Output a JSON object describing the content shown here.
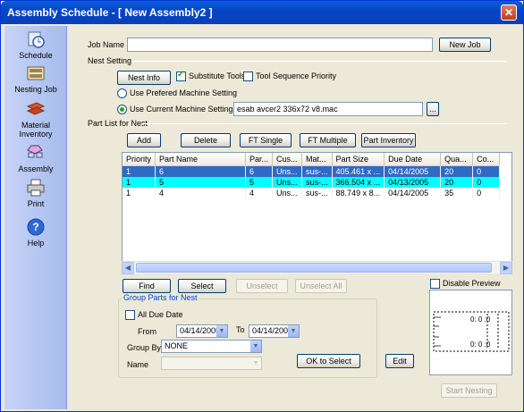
{
  "window": {
    "title": "Assembly Schedule - [ New Assembly2 ]",
    "close_glyph": "✕"
  },
  "sidebar": {
    "items": [
      {
        "label": "Schedule",
        "icon": "clock-icon"
      },
      {
        "label": "Nesting Job",
        "icon": "keyboard-icon"
      },
      {
        "label": "Material Inventory",
        "icon": "material-stack-icon"
      },
      {
        "label": "Assembly",
        "icon": "assembly-icon"
      },
      {
        "label": "Print",
        "icon": "printer-icon"
      },
      {
        "label": "Help",
        "icon": "help-icon"
      }
    ]
  },
  "job": {
    "label": "Job Name",
    "value": "",
    "new_job": "New Job"
  },
  "nest_setting": {
    "section": "Nest Setting",
    "nest_info": "Nest Info",
    "substitute_tools": "Substitute Tools",
    "tool_sequence": "Tool Sequence Priority",
    "use_preferred": "Use Prefered Machine Setting",
    "use_current": "Use Current Machine Setting",
    "machine_value": "esab avcer2 336x72 v8.mac",
    "browse": "..."
  },
  "part_list": {
    "section": "Part List for Nest",
    "buttons": [
      "Add",
      "Delete",
      "FT Single",
      "FT Multiple",
      "Part Inventory"
    ],
    "columns": [
      "Priority",
      "Part Name",
      "Par...",
      "Cus...",
      "Mat...",
      "Part Size",
      "Due Date",
      "Qua...",
      "Co..."
    ],
    "rows": [
      [
        "1",
        "6",
        "6",
        "Uns...",
        "sus-...",
        "405.461 x ...",
        "04/14/2005",
        "20",
        "0"
      ],
      [
        "1",
        "5",
        "5",
        "Uns...",
        "sus-...",
        "366.504 x ...",
        "04/13/2005",
        "20",
        "0"
      ],
      [
        "1",
        "4",
        "4",
        "Uns...",
        "sus-...",
        "88.749 x 8...",
        "04/14/2005",
        "35",
        "0"
      ]
    ]
  },
  "actions": {
    "find": "Find",
    "select": "Select",
    "unselect": "Unselect",
    "unselect_all": "Unselect All"
  },
  "group": {
    "title": "Group Parts for Nest",
    "all_due_date": "All Due Date",
    "from_label": "From",
    "from_value": "04/14/2005",
    "to_label": "To",
    "to_value": "04/14/2005",
    "group_by_label": "Group By",
    "group_by_value": "NONE",
    "name_label": "Name",
    "name_value": "",
    "ok_to_select": "OK to Select"
  },
  "edit": "Edit",
  "disable_preview": "Disable Preview",
  "start_nesting": "Start Nesting",
  "colors": {
    "selected_row": "#316AC5",
    "highlight_row": "#00FFFF",
    "title_bar": "#0646C6"
  }
}
